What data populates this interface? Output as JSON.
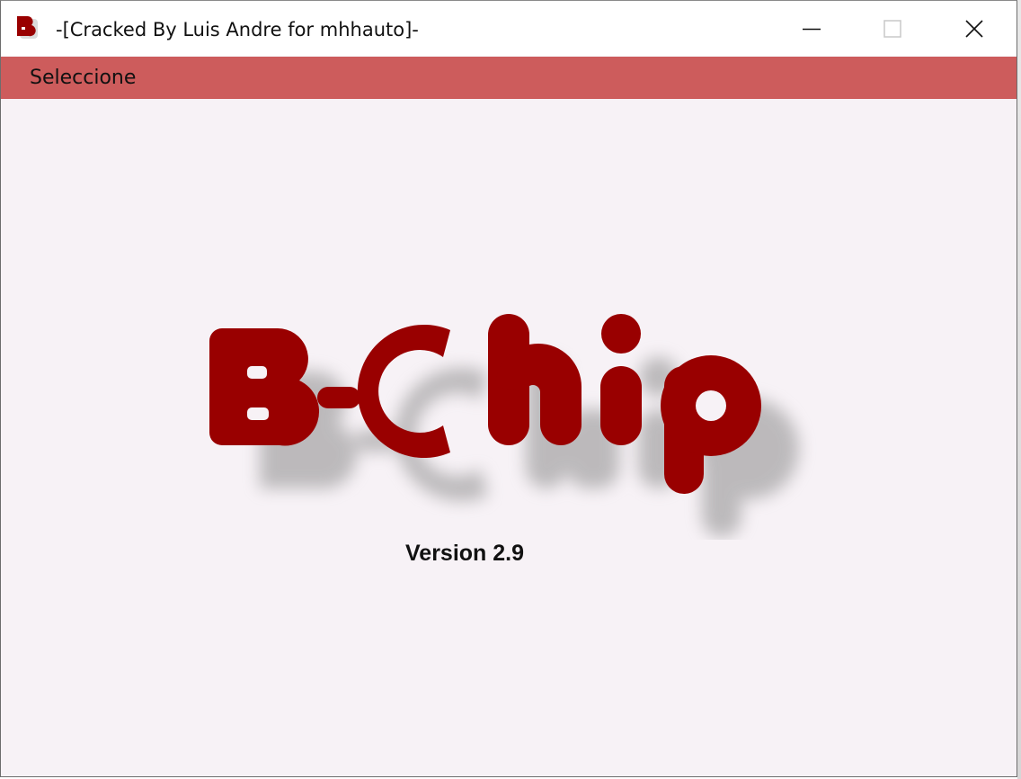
{
  "window": {
    "title": "-[Cracked By Luis Andre for mhhauto]-",
    "icon": "b-chip-app-icon",
    "controls": {
      "minimize_icon": "minimize-icon",
      "maximize_icon": "maximize-icon",
      "close_icon": "close-icon"
    }
  },
  "menubar": {
    "items": [
      {
        "label": "Seleccione"
      }
    ],
    "background_color": "#cd5c5c"
  },
  "splash": {
    "logo_text": "B-Chip",
    "logo_color": "#990000",
    "version": "Version 2.9"
  }
}
